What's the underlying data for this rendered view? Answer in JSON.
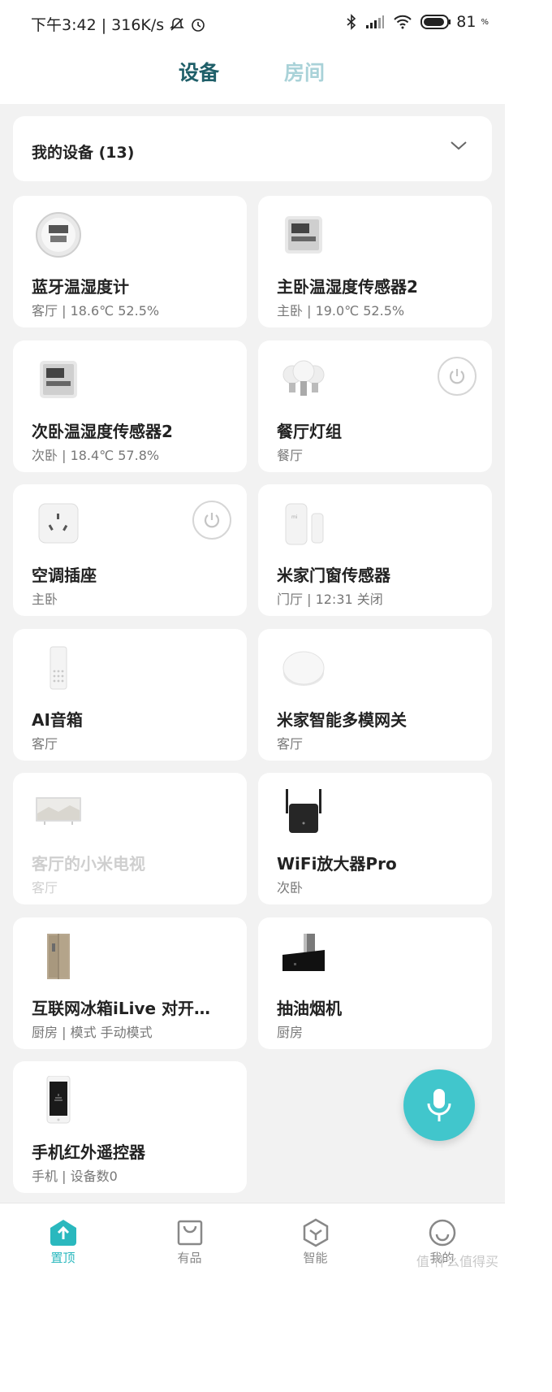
{
  "status_bar": {
    "time_speed": "下午3:42 | 316K/s",
    "battery_level": "81",
    "battery_unit": "%"
  },
  "tabs": {
    "devices": "设备",
    "rooms": "房间"
  },
  "my_devices": {
    "label": "我的设备 (13)"
  },
  "devices": [
    {
      "name": "蓝牙温湿度计",
      "sub": "客厅 | 18.6℃ 52.5%",
      "icon": "round-thermometer-icon"
    },
    {
      "name": "主卧温湿度传感器2",
      "sub": "主卧 | 19.0℃ 52.5%",
      "icon": "square-thermometer-icon"
    },
    {
      "name": "次卧温湿度传感器2",
      "sub": "次卧 | 18.4℃ 57.8%",
      "icon": "square-thermometer-icon"
    },
    {
      "name": "餐厅灯组",
      "sub": "餐厅",
      "icon": "bulb-group-icon"
    },
    {
      "name": "空调插座",
      "sub": "主卧",
      "icon": "plug-icon"
    },
    {
      "name": "米家门窗传感器",
      "sub": "门厅 | 12:31 关闭",
      "icon": "door-sensor-icon"
    },
    {
      "name": "AI音箱",
      "sub": "客厅",
      "icon": "speaker-icon"
    },
    {
      "name": "米家智能多模网关",
      "sub": "客厅",
      "icon": "gateway-icon"
    },
    {
      "name": "客厅的小米电视",
      "sub": "客厅",
      "icon": "tv-icon"
    },
    {
      "name": "WiFi放大器Pro",
      "sub": "次卧",
      "icon": "wifi-repeater-icon"
    },
    {
      "name": "互联网冰箱iLive 对开…",
      "sub": "厨房 | 模式 手动模式",
      "icon": "fridge-icon"
    },
    {
      "name": "抽油烟机",
      "sub": "厨房",
      "icon": "range-hood-icon"
    },
    {
      "name": "手机红外遥控器",
      "sub": "手机 | 设备数0",
      "icon": "phone-remote-icon"
    }
  ],
  "bottom_nav": {
    "home": "置顶",
    "store": "有品",
    "smart": "智能",
    "profile": "我的"
  },
  "watermark": "值 什么值得买",
  "colors": {
    "accent": "#41c6cc",
    "tab_active": "#1f5f69",
    "tab_inactive": "#a9d2d8",
    "nav_active": "#2ab8be"
  }
}
